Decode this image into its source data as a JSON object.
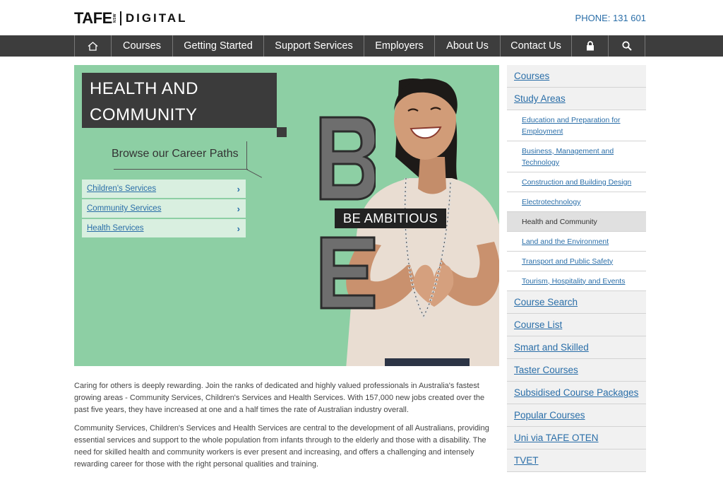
{
  "header": {
    "logo_main": "TAFE",
    "logo_state": "NSW",
    "logo_sub": "DIGITAL",
    "phone": "PHONE: 131 601"
  },
  "nav": {
    "home_icon": "home-icon",
    "items": [
      "Courses",
      "Getting Started",
      "Support Services",
      "Employers",
      "About Us",
      "Contact Us"
    ],
    "lock_icon": "lock-icon",
    "search_icon": "search-icon"
  },
  "hero": {
    "title_line1": "HEALTH AND",
    "title_line2": "COMMUNITY",
    "browse": "Browse our Career Paths",
    "career_paths": [
      "Children's Services",
      "Community Services",
      "Health Services"
    ],
    "badge": "BE AMBITIOUS",
    "letters": [
      "B",
      "E"
    ]
  },
  "body": {
    "para1": "Caring for others is deeply rewarding. Join the ranks of dedicated and highly valued professionals in Australia's fastest growing areas - Community Services, Children's Services and Health Services. With 157,000 new jobs created over the past five years, they have increased at one and a half times the rate of Australian industry overall.",
    "para2": "Community Services, Children's Services and Health Services are central to the development of all Australians, providing essential services and support to the whole population from infants through to the elderly and those with a disability. The need for skilled health and community workers is ever present and increasing, and offers a challenging and intensely rewarding career for those with the right personal qualities and training."
  },
  "sidebar": {
    "courses": "Courses",
    "study_areas": "Study Areas",
    "sub_items": [
      "Education and Preparation for Employment",
      "Business, Management and Technology",
      "Construction and Building Design",
      "Electrotechnology",
      "Health and Community",
      "Land and the Environment",
      "Transport and Public Safety",
      "Tourism, Hospitality and Events"
    ],
    "after_items": [
      "Course Search",
      "Course List",
      "Smart and Skilled",
      "Taster Courses",
      "Subsidised Course Packages",
      "Popular Courses",
      "Uni via TAFE OTEN",
      "TVET"
    ]
  },
  "colors": {
    "hero_bg": "#8dcfa4",
    "nav_bg": "#3d3d3d",
    "link": "#2a6ea8",
    "dark_box": "#3b3b3b"
  }
}
